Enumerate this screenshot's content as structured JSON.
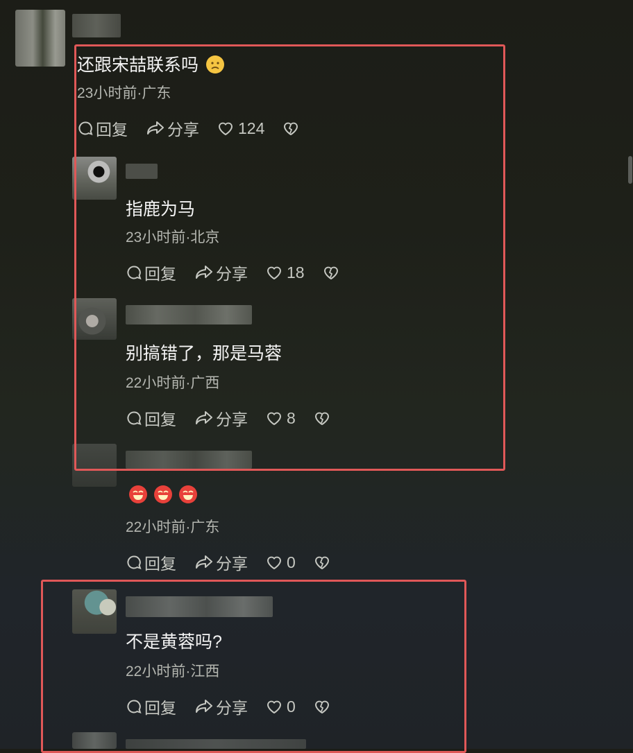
{
  "comments": [
    {
      "text": "还跟宋喆联系吗",
      "emoji": "sad-face-emoji",
      "meta": "23小时前·广东",
      "reply_label": "回复",
      "share_label": "分享",
      "likes": "124"
    },
    {
      "text": "指鹿为马",
      "meta": "23小时前·北京",
      "reply_label": "回复",
      "share_label": "分享",
      "likes": "18"
    },
    {
      "text": "别搞错了，那是马蓉",
      "meta": "22小时前·广西",
      "reply_label": "回复",
      "share_label": "分享",
      "likes": "8"
    },
    {
      "emojis": [
        "laughing-emoji",
        "laughing-emoji",
        "laughing-emoji"
      ],
      "meta": "22小时前·广东",
      "reply_label": "回复",
      "share_label": "分享",
      "likes": "0"
    },
    {
      "text": "不是黄蓉吗?",
      "meta": "22小时前·江西",
      "reply_label": "回复",
      "share_label": "分享",
      "likes": "0"
    }
  ],
  "colors": {
    "highlight_border": "#e05858",
    "text_primary": "#f4f4f4",
    "text_secondary": "#b4b6b0",
    "emoji_yellow": "#f5c542",
    "emoji_red": "#e8413a"
  }
}
